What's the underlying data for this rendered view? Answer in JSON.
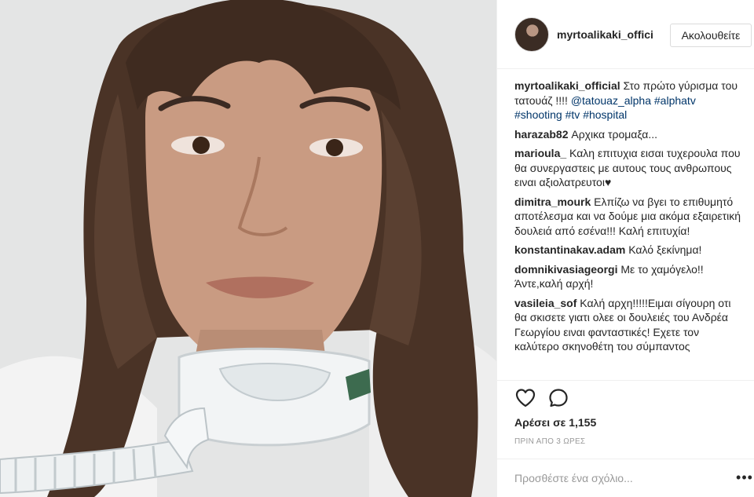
{
  "photo": {
    "alt": "post-photo",
    "colors": {
      "background": "#dcdddd",
      "hair": "#4a3326",
      "skin": "#c99b82",
      "mask": "#f2f4f5"
    }
  },
  "header": {
    "username": "myrtoalikaki_offici",
    "follow_label": "Ακολουθείτε"
  },
  "caption": {
    "user": "myrtoalikaki_official",
    "text": "Στο πρώτο γύρισμα του τατουάζ !!!! ",
    "mention": "@tatouaz_alpha",
    "tags": [
      "#alphatv",
      "#shooting",
      "#tv",
      "#hospital"
    ]
  },
  "comments": [
    {
      "user": "harazab82",
      "text": "Αρχικα τρομαξα..."
    },
    {
      "user": "marioula_",
      "text": "Καλη επιτυχια εισαι τυχερουλα που θα συνεργαστεις με αυτους τους ανθρωπους ειναι αξιολατρευτοι♥"
    },
    {
      "user": "dimitra_mourk",
      "text": "Ελπίζω να βγει το επιθυμητό αποτέλεσμα και να δούμε μια ακόμα εξαιρετική δουλειά από εσένα!!! Καλή επιτυχία!"
    },
    {
      "user": "konstantinakav.adam",
      "text": "Καλό ξεκίνημα!"
    },
    {
      "user": "domnikivasiageorgi",
      "text": "Με το χαμόγελο!! Άντε,καλή αρχή!"
    },
    {
      "user": "vasileia_sof",
      "text": "Καλή αρχη!!!!!Ειμαι σίγουρη οτι θα σκισετε γιατι ολεε οι δουλειές του Ανδρέα Γεωργίου ειναι φανταστικές! Εχετε τον καλύτερο σκηνοθέτη του σύμπαντος"
    }
  ],
  "actions": {
    "heart_icon": "heart-outline",
    "comment_icon": "speech-bubble",
    "likes": "Αρέσει σε 1,155",
    "time": "ΠΡΙΝ ΑΠΟ 3 ΩΡΕΣ"
  },
  "add_comment": {
    "placeholder": "Προσθέστε ένα σχόλιο...",
    "more_label": "•••"
  }
}
